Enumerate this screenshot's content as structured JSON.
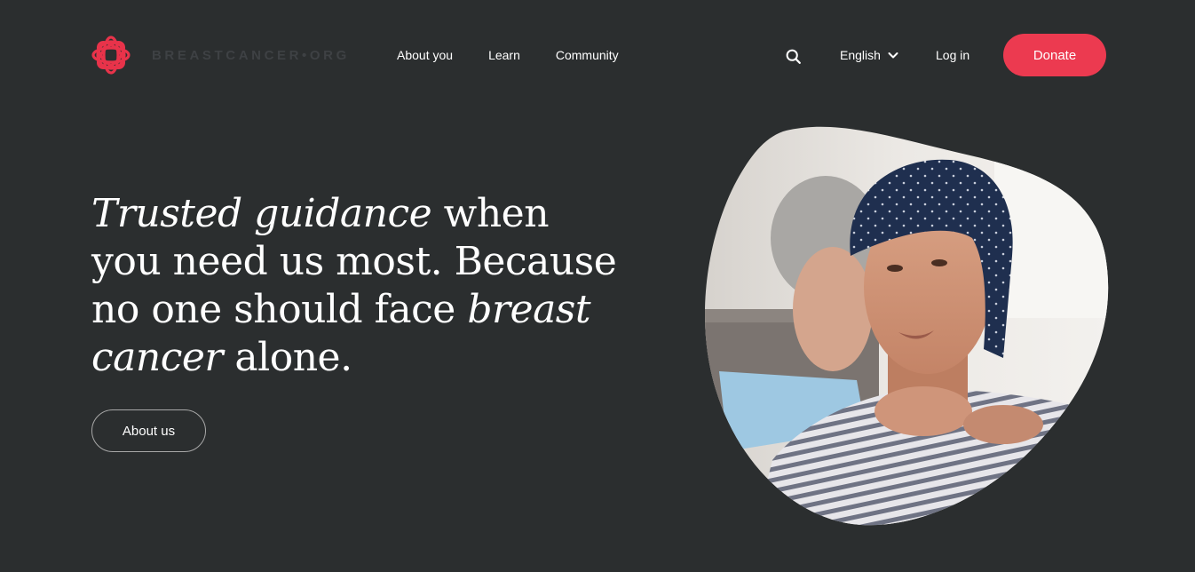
{
  "header": {
    "logo_text": "BREASTCANCER•ORG",
    "nav": [
      {
        "label": "About you"
      },
      {
        "label": "Learn"
      },
      {
        "label": "Community"
      }
    ],
    "search_icon": "search-icon",
    "language": "English",
    "login_label": "Log in",
    "donate_label": "Donate"
  },
  "hero": {
    "heading_parts": [
      {
        "text": "Trusted guidance",
        "italic": true
      },
      {
        "text": " when you need us most. Because no one should face ",
        "italic": false
      },
      {
        "text": "breast cancer",
        "italic": true
      },
      {
        "text": " alone.",
        "italic": false
      }
    ],
    "about_button_label": "About us"
  },
  "colors": {
    "background": "#2b2e2f",
    "accent": "#ec3a50",
    "text": "#ffffff",
    "logo_text": "#3e4144"
  }
}
